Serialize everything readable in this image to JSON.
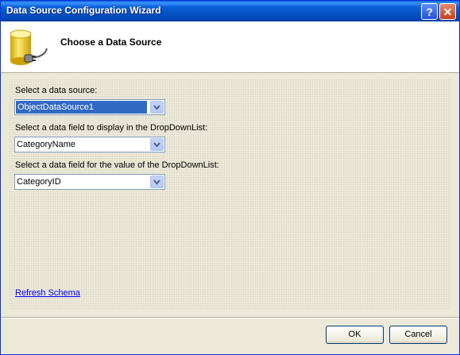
{
  "window": {
    "title": "Data Source Configuration Wizard",
    "help_glyph": "?",
    "close_glyph": "✕"
  },
  "header": {
    "title": "Choose a Data Source",
    "icon": "database-plug-icon"
  },
  "form": {
    "data_source_label": "Select a data source:",
    "data_source_value": "ObjectDataSource1",
    "display_field_label": "Select a data field to display in the DropDownList:",
    "display_field_value": "CategoryName",
    "value_field_label": "Select a data field for the value of the DropDownList:",
    "value_field_value": "CategoryID"
  },
  "links": {
    "refresh_schema": "Refresh Schema"
  },
  "buttons": {
    "ok": "OK",
    "cancel": "Cancel"
  },
  "colors": {
    "titlebar": "#0a5fd8",
    "selection": "#316ac5",
    "dialog_bg": "#ece9d8",
    "link": "#0000ff"
  }
}
